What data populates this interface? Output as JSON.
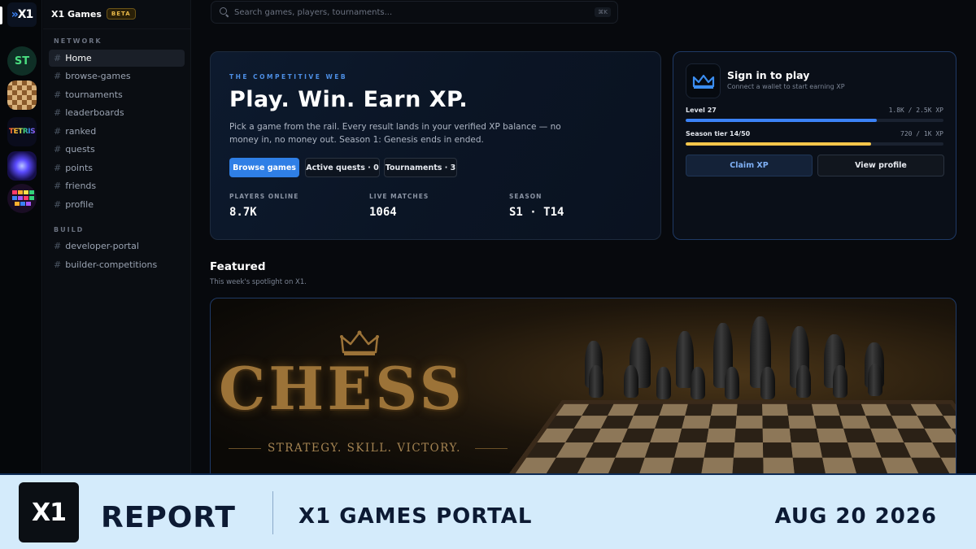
{
  "rail": {
    "logo": "X1",
    "games": [
      {
        "name": "st-game-icon",
        "label": "ST"
      },
      {
        "name": "chess-game-icon"
      },
      {
        "name": "tetris-game-icon",
        "label": "TETRIS"
      },
      {
        "name": "space-shooter-game-icon"
      },
      {
        "name": "block-breaker-game-icon"
      }
    ]
  },
  "sidebar": {
    "brand": "X1 Games",
    "badge": "BETA",
    "network_label": "NETWORK",
    "network_items": [
      "Home",
      "browse-games",
      "tournaments",
      "leaderboards",
      "ranked",
      "quests",
      "points",
      "friends",
      "profile"
    ],
    "build_label": "BUILD",
    "build_items": [
      "developer-portal",
      "builder-competitions"
    ],
    "hash": "#"
  },
  "search": {
    "placeholder": "Search games, players, tournaments...",
    "shortcut": "⌘K"
  },
  "hero": {
    "eyebrow": "THE COMPETITIVE WEB",
    "title": "Play. Win. Earn XP.",
    "description": "Pick a game from the rail. Every result lands in your verified XP balance — no money in, no money out. Season 1: Genesis ends in ended.",
    "buttons": {
      "browse": "Browse games",
      "quests": "Active quests · 0",
      "tournaments": "Tournaments · 3"
    },
    "stats": [
      {
        "label": "PLAYERS ONLINE",
        "value": "8.7K"
      },
      {
        "label": "LIVE MATCHES",
        "value": "1064"
      },
      {
        "label": "SEASON",
        "value": "S1 · T14"
      }
    ]
  },
  "signin": {
    "title": "Sign in to play",
    "subtitle": "Connect a wallet to start earning XP",
    "level": {
      "label": "Level 27",
      "value": "1.8K / 2.5K XP",
      "progress": 0.74,
      "color": "#3b82f6"
    },
    "season": {
      "label": "Season tier 14/50",
      "value": "720 / 1K XP",
      "progress": 0.72,
      "color": "#f5c64a"
    },
    "claim": "Claim XP",
    "view": "View profile"
  },
  "featured": {
    "title": "Featured",
    "subtitle": "This week's spotlight on X1.",
    "banner": {
      "word": "CHESS",
      "tagline": "STRATEGY. SKILL. VICTORY."
    }
  },
  "footer": {
    "logo": "X1",
    "report": "REPORT",
    "title": "X1 GAMES PORTAL",
    "date": "AUG 20 2026"
  },
  "colors": {
    "accent": "#2f7fe6",
    "gold": "#f5c64a",
    "background": "#07090d"
  }
}
